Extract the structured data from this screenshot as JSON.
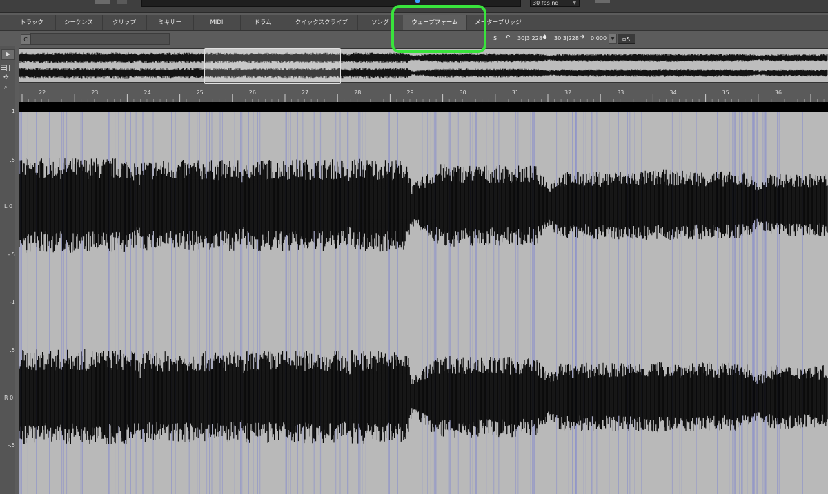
{
  "top": {
    "fps": "30 fps nd"
  },
  "tabs": [
    "トラック",
    "シーケンス",
    "クリップ",
    "ミキサー",
    "MIDI",
    "ドラム",
    "クイックスクライブ",
    "ソング",
    "ウェーブフォーム",
    "メーターブリッジ"
  ],
  "active_tab": "ウェーブフォーム",
  "toolbar": {
    "c_label": "C",
    "s_label": "S",
    "start": "30|3|228",
    "end": "30|3|228",
    "length": "0|000"
  },
  "ruler": {
    "bars": [
      "22",
      "23",
      "24",
      "25",
      "26",
      "27",
      "28",
      "29",
      "30",
      "31",
      "32",
      "33",
      "34",
      "35",
      "36"
    ]
  },
  "amplitude_labels": {
    "left": [
      "1",
      ".5",
      "L  0",
      "-.5",
      "-1"
    ],
    "right": [
      ".5",
      "R  0",
      "-.5"
    ]
  },
  "colors": {
    "highlight": "#39e33c",
    "waveform": "#000000",
    "marker": "#8a8fcc",
    "background": "#b9b9b9"
  }
}
